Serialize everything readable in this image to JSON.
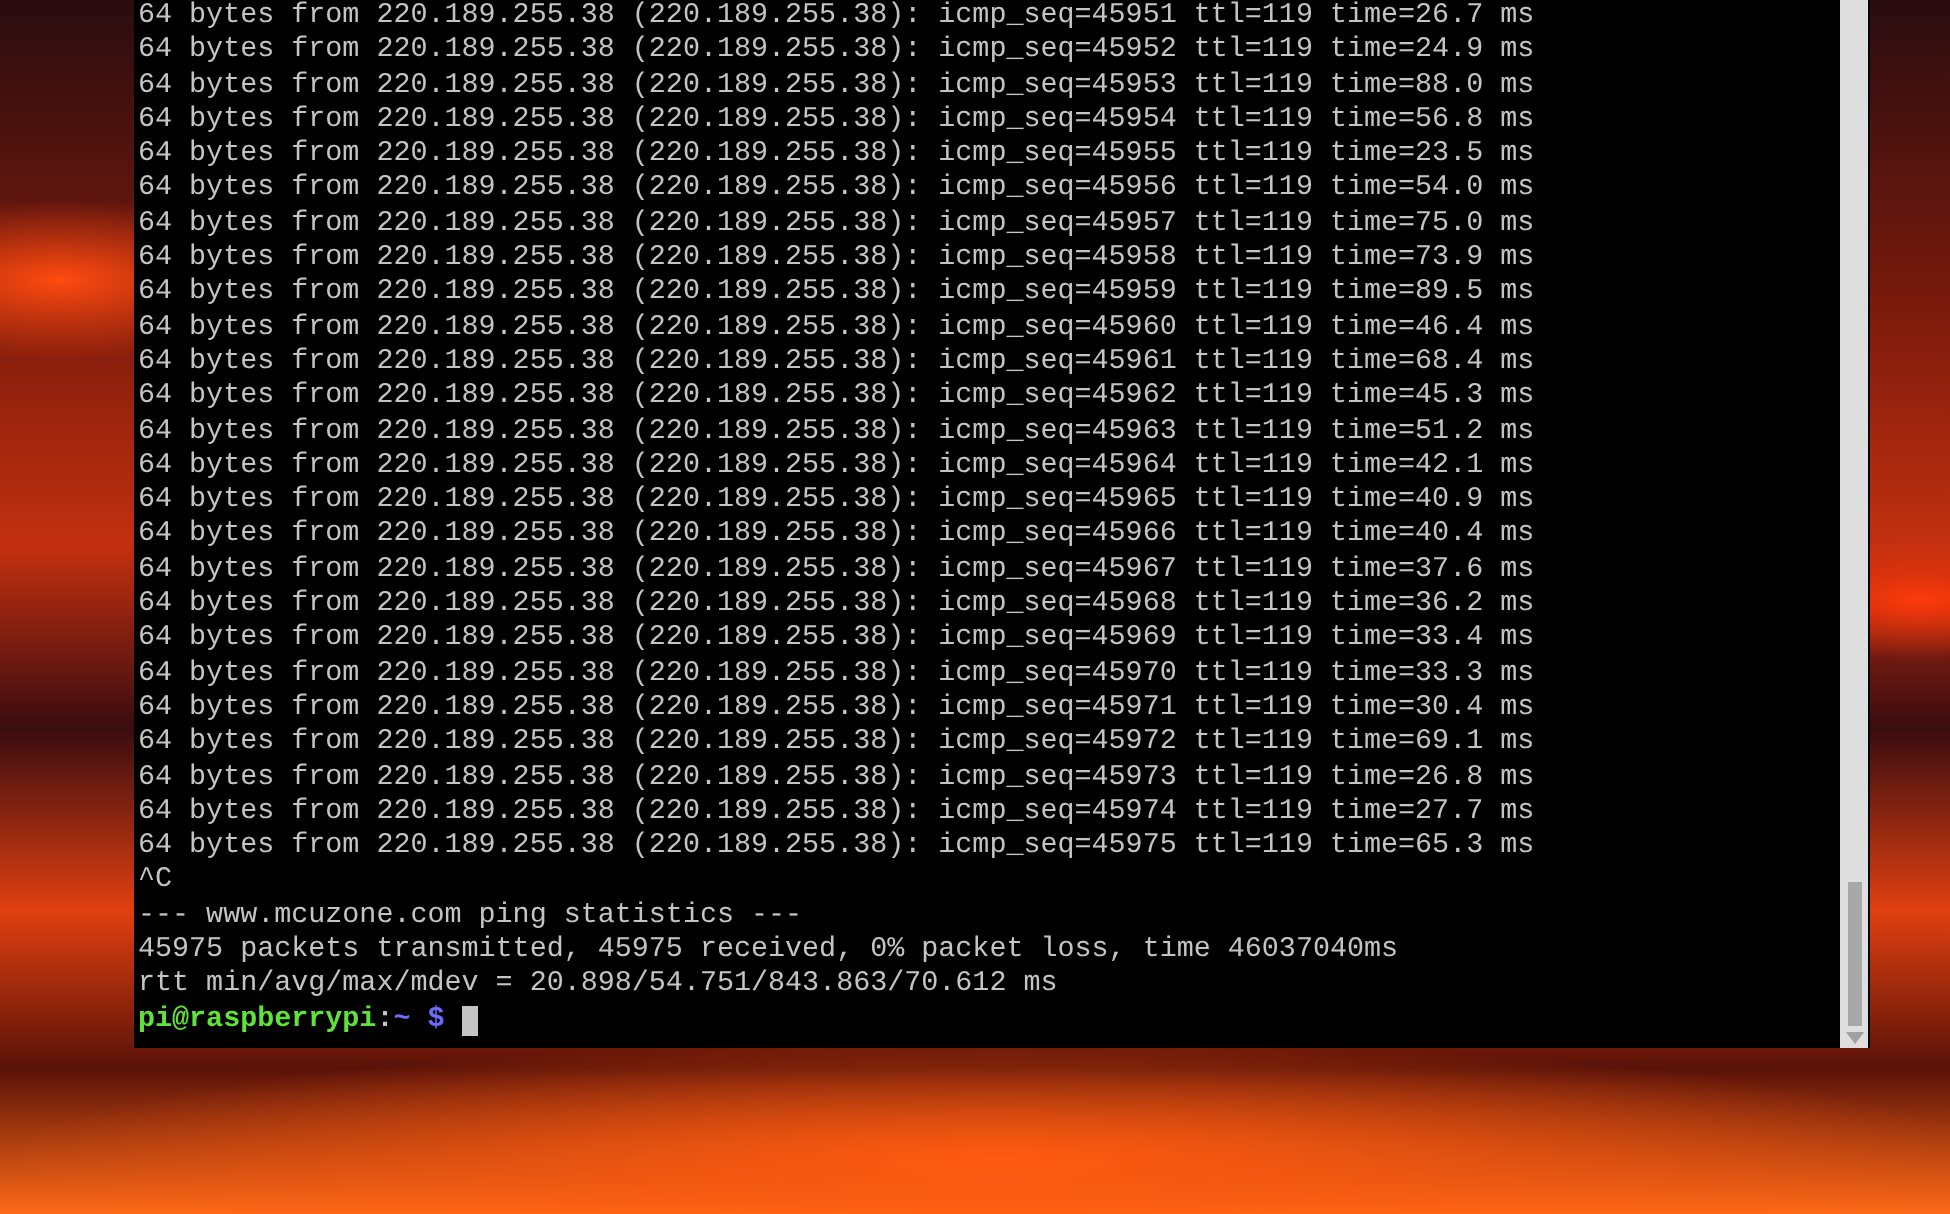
{
  "terminal": {
    "lines": [
      "64 bytes from 220.189.255.38 (220.189.255.38): icmp_seq=45951 ttl=119 time=26.7 ms",
      "64 bytes from 220.189.255.38 (220.189.255.38): icmp_seq=45952 ttl=119 time=24.9 ms",
      "64 bytes from 220.189.255.38 (220.189.255.38): icmp_seq=45953 ttl=119 time=88.0 ms",
      "64 bytes from 220.189.255.38 (220.189.255.38): icmp_seq=45954 ttl=119 time=56.8 ms",
      "64 bytes from 220.189.255.38 (220.189.255.38): icmp_seq=45955 ttl=119 time=23.5 ms",
      "64 bytes from 220.189.255.38 (220.189.255.38): icmp_seq=45956 ttl=119 time=54.0 ms",
      "64 bytes from 220.189.255.38 (220.189.255.38): icmp_seq=45957 ttl=119 time=75.0 ms",
      "64 bytes from 220.189.255.38 (220.189.255.38): icmp_seq=45958 ttl=119 time=73.9 ms",
      "64 bytes from 220.189.255.38 (220.189.255.38): icmp_seq=45959 ttl=119 time=89.5 ms",
      "64 bytes from 220.189.255.38 (220.189.255.38): icmp_seq=45960 ttl=119 time=46.4 ms",
      "64 bytes from 220.189.255.38 (220.189.255.38): icmp_seq=45961 ttl=119 time=68.4 ms",
      "64 bytes from 220.189.255.38 (220.189.255.38): icmp_seq=45962 ttl=119 time=45.3 ms",
      "64 bytes from 220.189.255.38 (220.189.255.38): icmp_seq=45963 ttl=119 time=51.2 ms",
      "64 bytes from 220.189.255.38 (220.189.255.38): icmp_seq=45964 ttl=119 time=42.1 ms",
      "64 bytes from 220.189.255.38 (220.189.255.38): icmp_seq=45965 ttl=119 time=40.9 ms",
      "64 bytes from 220.189.255.38 (220.189.255.38): icmp_seq=45966 ttl=119 time=40.4 ms",
      "64 bytes from 220.189.255.38 (220.189.255.38): icmp_seq=45967 ttl=119 time=37.6 ms",
      "64 bytes from 220.189.255.38 (220.189.255.38): icmp_seq=45968 ttl=119 time=36.2 ms",
      "64 bytes from 220.189.255.38 (220.189.255.38): icmp_seq=45969 ttl=119 time=33.4 ms",
      "64 bytes from 220.189.255.38 (220.189.255.38): icmp_seq=45970 ttl=119 time=33.3 ms",
      "64 bytes from 220.189.255.38 (220.189.255.38): icmp_seq=45971 ttl=119 time=30.4 ms",
      "64 bytes from 220.189.255.38 (220.189.255.38): icmp_seq=45972 ttl=119 time=69.1 ms",
      "64 bytes from 220.189.255.38 (220.189.255.38): icmp_seq=45973 ttl=119 time=26.8 ms",
      "64 bytes from 220.189.255.38 (220.189.255.38): icmp_seq=45974 ttl=119 time=27.7 ms",
      "64 bytes from 220.189.255.38 (220.189.255.38): icmp_seq=45975 ttl=119 time=65.3 ms",
      "^C",
      "--- www.mcuzone.com ping statistics ---",
      "45975 packets transmitted, 45975 received, 0% packet loss, time 46037040ms",
      "rtt min/avg/max/mdev = 20.898/54.751/843.863/70.612 ms"
    ],
    "prompt": {
      "user_host": "pi@raspberrypi",
      "separator": ":",
      "path": "~",
      "symbol": "$"
    }
  }
}
